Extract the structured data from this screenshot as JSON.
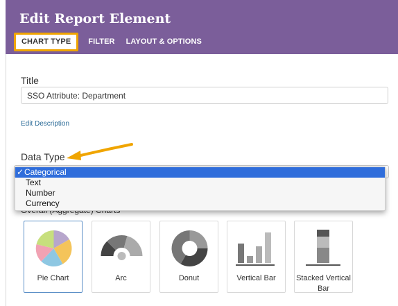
{
  "header": {
    "title": "Edit Report Element",
    "tabs": [
      {
        "label": "CHART TYPE",
        "active": true
      },
      {
        "label": "FILTER",
        "active": false
      },
      {
        "label": "LAYOUT & OPTIONS",
        "active": false
      }
    ],
    "bg_color": "#7b5e9a",
    "highlight_color": "#f0a500"
  },
  "form": {
    "title_label": "Title",
    "title_value": "SSO Attribute: Department",
    "edit_description": "Edit Description",
    "data_type_label": "Data Type",
    "data_type_options": [
      {
        "label": "Categorical",
        "selected": true
      },
      {
        "label": "Text",
        "selected": false
      },
      {
        "label": "Number",
        "selected": false
      },
      {
        "label": "Currency",
        "selected": false
      }
    ],
    "check_mark": "✓",
    "overall_charts_label": "Overall (Aggregate) Charts"
  },
  "charts": [
    {
      "label": "Pie Chart",
      "icon": "pie-chart-icon",
      "selected": true
    },
    {
      "label": "Arc",
      "icon": "arc-chart-icon",
      "selected": false
    },
    {
      "label": "Donut",
      "icon": "donut-chart-icon",
      "selected": false
    },
    {
      "label": "Vertical Bar",
      "icon": "vertical-bar-icon",
      "selected": false
    },
    {
      "label": "Stacked Vertical Bar",
      "icon": "stacked-vertical-bar-icon",
      "selected": false
    }
  ],
  "colors": {
    "select_highlight": "#2f6ddb",
    "link": "#2a6a97"
  }
}
